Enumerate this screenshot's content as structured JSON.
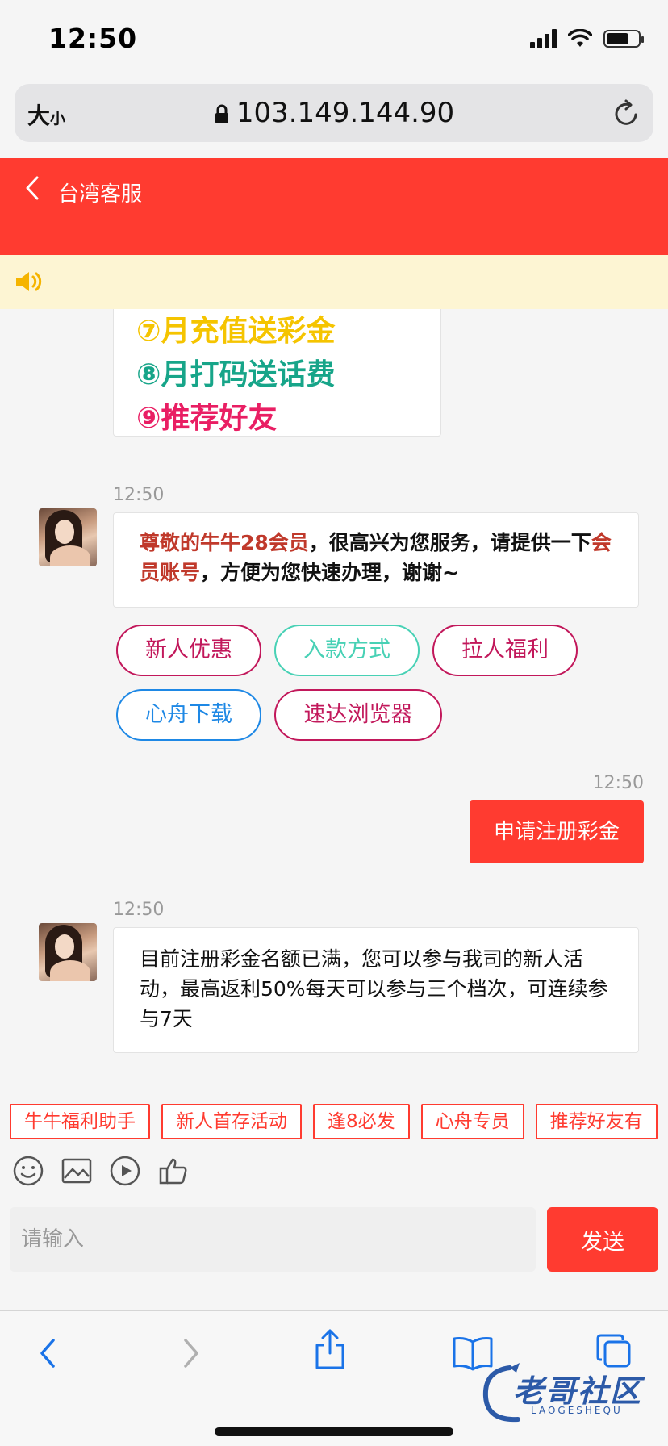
{
  "status_bar": {
    "time": "12:50"
  },
  "address_bar": {
    "text_size_big": "大",
    "text_size_small": "小",
    "url": "103.149.144.90"
  },
  "header": {
    "title": "台湾客服"
  },
  "promo_lines": [
    {
      "text": "⑦月充值送彩金",
      "color": "#f5c400"
    },
    {
      "text": "⑧月打码送话费",
      "color": "#17a589"
    },
    {
      "text": "⑨推荐好友",
      "color": "#e91e63"
    }
  ],
  "messages": {
    "agent1": {
      "time": "12:50",
      "part1": "尊敬的牛牛28会员",
      "part2": "，很高兴为您服务，请提供一下",
      "part3": "会员账号",
      "part4": "，方便为您快速办理，谢谢~"
    },
    "user1": {
      "time": "12:50",
      "text": "申请注册彩金"
    },
    "agent2": {
      "time": "12:50",
      "text": "目前注册彩金名额已满，您可以参与我司的新人活动，最高返利50%每天可以参与三个档次，可连续参与7天"
    }
  },
  "quick_buttons": [
    {
      "label": "新人优惠",
      "color": "#c2185b"
    },
    {
      "label": "入款方式",
      "color": "#48d1b5"
    },
    {
      "label": "拉人福利",
      "color": "#c2185b"
    },
    {
      "label": "心舟下载",
      "color": "#1e88e5"
    },
    {
      "label": "速达浏览器",
      "color": "#c2185b"
    }
  ],
  "shortcut_tags": [
    "牛牛福利助手",
    "新人首存活动",
    "逢8必发",
    "心舟专员",
    "推荐好友有"
  ],
  "toolbar_icons": [
    "emoji-icon",
    "image-icon",
    "video-icon",
    "thumbs-up-icon"
  ],
  "input": {
    "placeholder": "请输入",
    "send_label": "发送"
  },
  "watermark": {
    "text": "老哥社区",
    "sub": "LAOGESHEQU"
  },
  "colors": {
    "brand_red": "#ff3b30",
    "notice_bg": "#fdf5d3",
    "safari_blue": "#1a73e8"
  }
}
